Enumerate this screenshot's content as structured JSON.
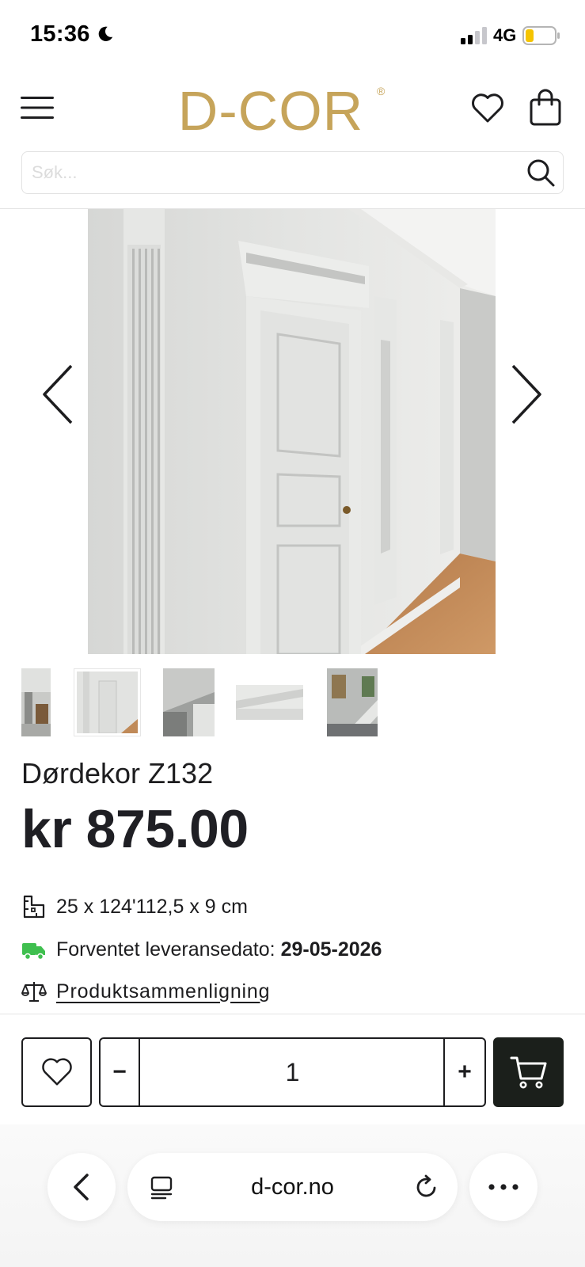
{
  "status_bar": {
    "time": "15:36",
    "network": "4G",
    "battery_level": 0.25
  },
  "header": {
    "logo_text": "D-COR",
    "logo_mark": "®",
    "brand_color": "#c6a45a"
  },
  "search": {
    "placeholder": "Søk...",
    "value": ""
  },
  "gallery": {
    "thumbnail_count": 5,
    "active_thumbnail": 2
  },
  "product": {
    "title": "Dørdekor Z132",
    "price": "kr 875.00",
    "dimensions": "25 x 124'112,5 x 9 cm",
    "delivery_label": "Forventet leveransedato:",
    "delivery_date": "29-05-2026",
    "compare_link": "Produktsammenligning"
  },
  "purchase": {
    "minus_label": "−",
    "quantity": "1",
    "plus_label": "+"
  },
  "browser": {
    "url": "d-cor.no"
  },
  "colors": {
    "accent_green": "#3fbf4f",
    "dark_button": "#1b1f1b",
    "text": "#1d1d1f"
  }
}
